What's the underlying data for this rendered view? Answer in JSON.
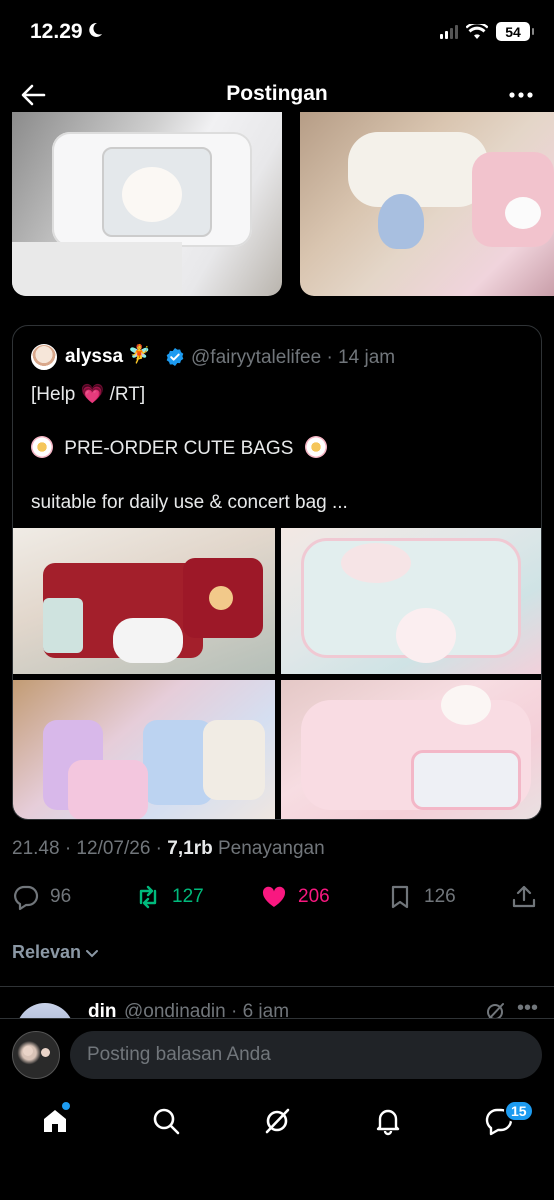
{
  "status": {
    "time": "12.29",
    "battery": "54"
  },
  "header": {
    "title": "Postingan"
  },
  "quoted_post": {
    "display_name": "alyssa",
    "name_emoji": "🧚",
    "handle_time": "@fairyytalelifee · 14 jam",
    "line1_prefix": "[Help ",
    "line1_heart": "💗",
    "line1_suffix": " /RT]",
    "line2": "PRE-ORDER CUTE BAGS",
    "line3": "suitable for daily use & concert bag ..."
  },
  "meta": {
    "time_date": "21.48 · 12/07/26 · ",
    "views_count": "7,1rb",
    "views_label": " Penayangan"
  },
  "actions": {
    "replies": "96",
    "reposts": "127",
    "likes": "206",
    "bookmarks": "126"
  },
  "sort": {
    "label": "Relevan"
  },
  "reply": {
    "name": "din",
    "handle_time": "@ondinadin · 6 jam"
  },
  "composer": {
    "placeholder": "Posting balasan Anda"
  },
  "tabbar": {
    "messages_badge": "15"
  },
  "colors": {
    "repost": "#00ba7c",
    "like": "#f91880",
    "accent": "#1d9bf0",
    "muted": "#71767b"
  }
}
